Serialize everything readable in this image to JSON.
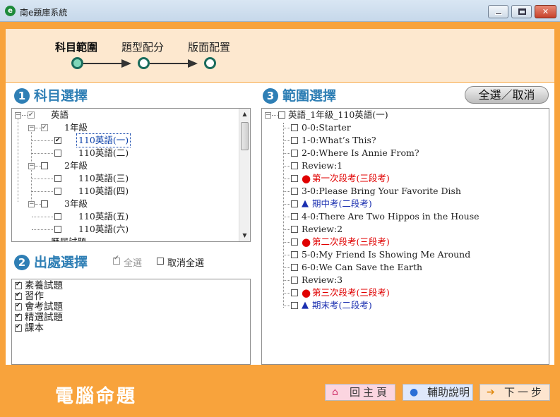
{
  "window": {
    "title": "南e題庫系統",
    "app_icon_letter": "e"
  },
  "steps": [
    {
      "label": "科目範圍",
      "active": true
    },
    {
      "label": "題型配分",
      "active": false
    },
    {
      "label": "版面配置",
      "active": false
    }
  ],
  "sections": {
    "subject": {
      "num": "1",
      "title": "科目選擇"
    },
    "origin": {
      "num": "2",
      "title": "出處選擇",
      "select_all": "全選",
      "deselect_all": "取消全選"
    },
    "range": {
      "num": "3",
      "title": "範圍選擇",
      "toggle_all": "全選／取消"
    }
  },
  "subject_tree": [
    {
      "label": "英語",
      "checked": true
    },
    {
      "label": "1年級",
      "checked": true
    },
    {
      "label": "110英語(一)",
      "checked": true,
      "selected": true
    },
    {
      "label": "110英語(二)",
      "checked": false
    },
    {
      "label": "2年級",
      "checked": false
    },
    {
      "label": "110英語(三)",
      "checked": false
    },
    {
      "label": "110英語(四)",
      "checked": false
    },
    {
      "label": "3年級",
      "checked": false
    },
    {
      "label": "110英語(五)",
      "checked": false
    },
    {
      "label": "110英語(六)",
      "checked": false
    },
    {
      "label": "歷屆試題",
      "checked": false
    }
  ],
  "origin_list": [
    {
      "label": "素養試題",
      "checked": true
    },
    {
      "label": "習作",
      "checked": true
    },
    {
      "label": "會考試題",
      "checked": true
    },
    {
      "label": "精選試題",
      "checked": true
    },
    {
      "label": "課本",
      "checked": true
    }
  ],
  "range_tree": {
    "root": "英語_1年級_110英語(一)",
    "items": [
      {
        "label": "0-0:Starter",
        "style": "normal"
      },
      {
        "label": "1-0:What’s This?",
        "style": "normal"
      },
      {
        "label": "2-0:Where Is Annie From?",
        "style": "normal"
      },
      {
        "label": "Review:1",
        "style": "normal"
      },
      {
        "label": "第一次段考(三段考)",
        "style": "red",
        "marker": "●"
      },
      {
        "label": "3-0:Please Bring Your Favorite Dish",
        "style": "normal"
      },
      {
        "label": "期中考(二段考)",
        "style": "blue",
        "marker": "▲"
      },
      {
        "label": "4-0:There Are Two Hippos in the House",
        "style": "normal"
      },
      {
        "label": "Review:2",
        "style": "normal"
      },
      {
        "label": "第二次段考(三段考)",
        "style": "red",
        "marker": "●"
      },
      {
        "label": "5-0:My Friend Is Showing Me Around",
        "style": "normal"
      },
      {
        "label": "6-0:We Can Save the Earth",
        "style": "normal"
      },
      {
        "label": "Review:3",
        "style": "normal"
      },
      {
        "label": "第三次段考(三段考)",
        "style": "red",
        "marker": "●"
      },
      {
        "label": "期末考(二段考)",
        "style": "blue",
        "marker": "▲"
      }
    ]
  },
  "footer": {
    "title": "電腦命題",
    "home": "回主頁",
    "help": "輔助說明",
    "next": "下一步"
  },
  "colors": {
    "accent": "#f8a33c",
    "panel": "#fde8cf",
    "section_title": "#2f7fb5",
    "red": "#e00000",
    "blue": "#1a2fb0"
  }
}
